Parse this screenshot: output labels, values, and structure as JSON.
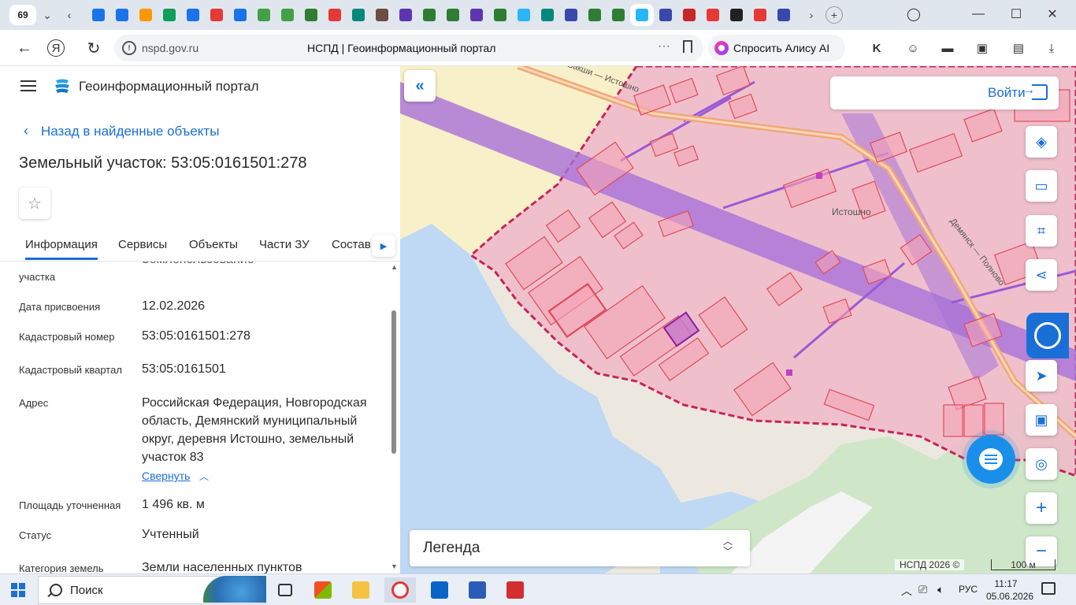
{
  "browser": {
    "tab_count": "69",
    "url_host": "nspd.gov.ru",
    "page_title": "НСПД | Геоинформационный портал",
    "alice_label": "Спросить Алису AI",
    "favicons": [
      "#1a73e8",
      "#1a73e8",
      "#ff9800",
      "#0f9d58",
      "#1a73e8",
      "#e53935",
      "#1a73e8",
      "#43a047",
      "#43a047",
      "#2e7d32",
      "#e53935",
      "#00897b",
      "#6d4c41",
      "#5e35b1",
      "#2e7d32",
      "#2e7d32",
      "#5e35b1",
      "#2e7d32",
      "#29b6f6",
      "#00897b",
      "#3949ab",
      "#2e7d32",
      "#2e7d32",
      "#29b6f6",
      "#3949ab",
      "#c62828",
      "#e53935",
      "#212121",
      "#e53935",
      "#3949ab"
    ]
  },
  "panel": {
    "portal_name": "Геоинформационный портал",
    "back_label": "Назад в найденные объекты",
    "parcel_title": "Земельный участок: 53:05:0161501:278",
    "tabs": [
      "Информация",
      "Сервисы",
      "Объекты",
      "Части ЗУ",
      "Состав"
    ],
    "rows": {
      "usage_label": "участка",
      "usage_value": "Землепользование",
      "date_label": "Дата присвоения",
      "date_value": "12.02.2026",
      "cadnum_label": "Кадастровый номер",
      "cadnum_value": "53:05:0161501:278",
      "quarter_label": "Кадастровый квартал",
      "quarter_value": "53:05:0161501",
      "address_label": "Адрес",
      "address_value": "Российская Федерация, Новгородская область, Демянский муниципальный округ, деревня Истошно, земельный участок 83",
      "collapse_label": "Свернуть",
      "area_label": "Площадь уточненная",
      "area_value": "1 496 кв. м",
      "status_label": "Статус",
      "status_value": "Учтенный",
      "category_label": "Категория земель",
      "category_value": "Земли населенных пунктов"
    }
  },
  "map": {
    "login_label": "Войти",
    "legend_label": "Легенда",
    "copyright": "НСПД 2026 ©",
    "scale_label": "100 м",
    "place_label": "Истошно",
    "road_label_1": "Бакши — Истошно",
    "road_label_2": "Демянск — Полново"
  },
  "taskbar": {
    "search_label": "Поиск",
    "lang": "РУС",
    "time": "11:17",
    "date": "05.06.2026"
  }
}
